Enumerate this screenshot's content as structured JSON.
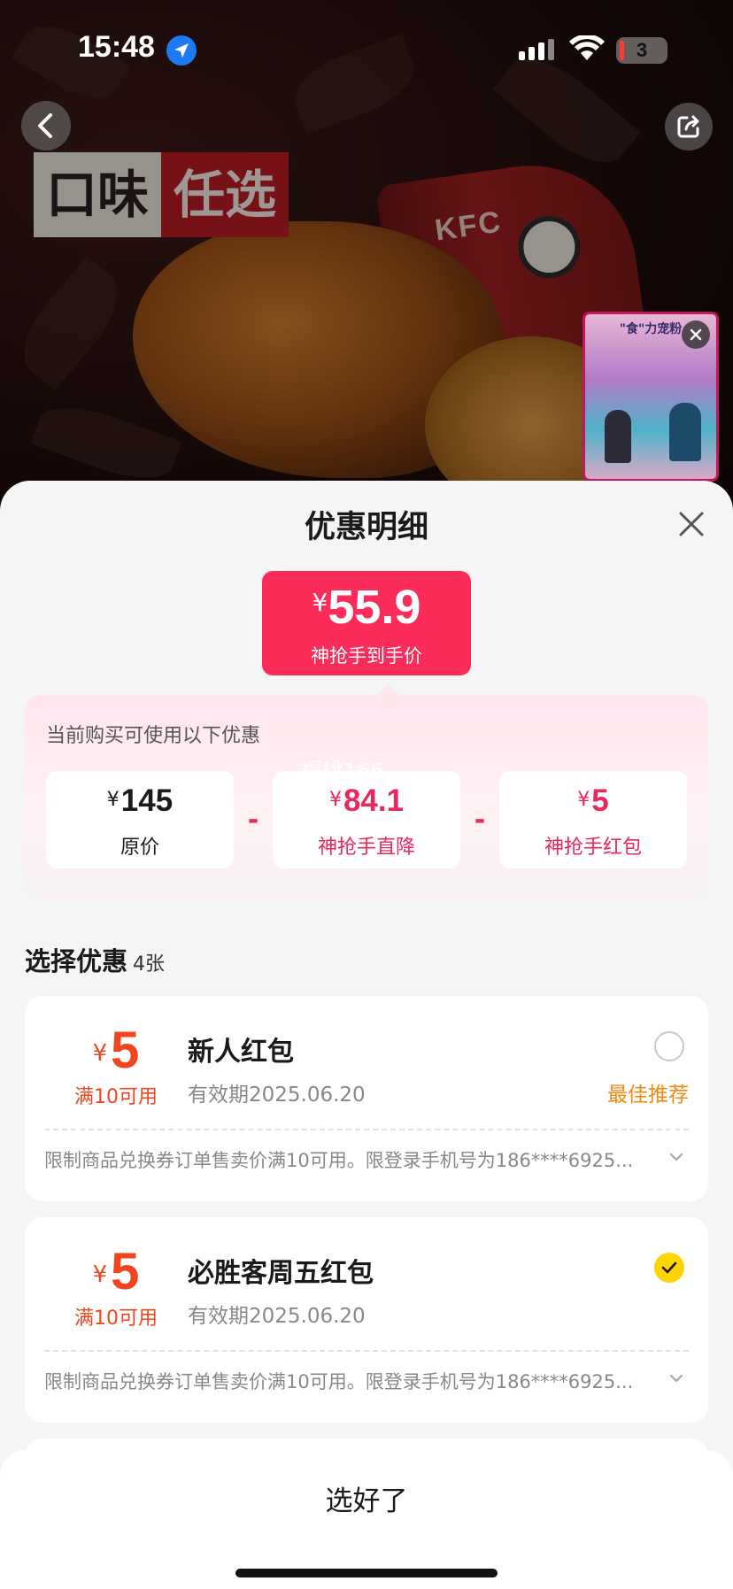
{
  "status_bar": {
    "time": "15:48",
    "battery": "3"
  },
  "hero": {
    "badge_part1": "口味",
    "badge_part2": "任选",
    "brand_text": "KFC",
    "live_title": "\"食\"力宠粉"
  },
  "sheet": {
    "title": "优惠明细",
    "final_price": {
      "currency": "¥",
      "value": "55.9",
      "label": "神抢手到手价"
    },
    "breakdown_label": "当前购买可使用以下优惠",
    "watermark": "樱桃166",
    "breakdown": [
      {
        "currency": "¥",
        "value": "145",
        "label": "原价"
      },
      {
        "currency": "¥",
        "value": "84.1",
        "label": "神抢手直降"
      },
      {
        "currency": "¥",
        "value": "5",
        "label": "神抢手红包"
      }
    ],
    "operator": "-",
    "section_title": "选择优惠",
    "section_count": "4张",
    "coupons": [
      {
        "currency": "¥",
        "amount": "5",
        "condition": "满10可用",
        "name": "新人红包",
        "expiry": "有效期2025.06.20",
        "tag": "最佳推荐",
        "selected": false,
        "description": "限制商品兑换券订单售卖价满10可用。限登录手机号为186****6925..."
      },
      {
        "currency": "¥",
        "amount": "5",
        "condition": "满10可用",
        "name": "必胜客周五红包",
        "expiry": "有效期2025.06.20",
        "tag": "",
        "selected": true,
        "description": "限制商品兑换券订单售卖价满10可用。限登录手机号为186****6925..."
      }
    ],
    "confirm_label": "选好了"
  },
  "colors": {
    "accent_pink": "#fb2c5a",
    "coupon_orange": "#f0451e",
    "recommend_orange": "#ef8a12",
    "check_yellow": "#ffd400"
  }
}
